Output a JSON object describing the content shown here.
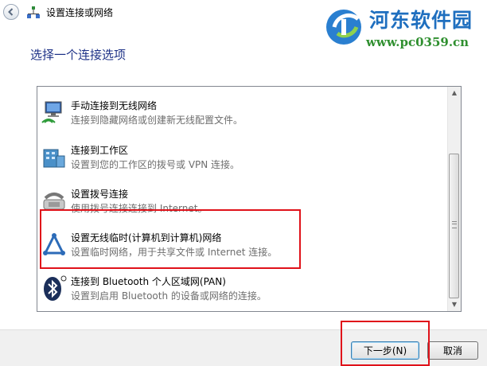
{
  "window": {
    "title": "设置连接或网络"
  },
  "watermark": {
    "name": "河东软件园",
    "url": "www.pc0359.cn"
  },
  "heading": "选择一个连接选项",
  "options": [
    {
      "title": "手动连接到无线网络",
      "description": "连接到隐藏网络或创建新无线配置文件。",
      "icon": "wireless-network-icon"
    },
    {
      "title": "连接到工作区",
      "description": "设置到您的工作区的拨号或 VPN 连接。",
      "icon": "workplace-icon"
    },
    {
      "title": "设置拨号连接",
      "description": "使用拨号连接连接到 Internet。",
      "icon": "dialup-phone-icon"
    },
    {
      "title": "设置无线临时(计算机到计算机)网络",
      "description": "设置临时网络，用于共享文件或 Internet 连接。",
      "icon": "adhoc-network-icon"
    },
    {
      "title": "连接到 Bluetooth 个人区域网(PAN)",
      "description": "设置到启用 Bluetooth 的设备或网络的连接。",
      "icon": "bluetooth-icon"
    }
  ],
  "buttons": {
    "next": "下一步(N)",
    "cancel": "取消"
  },
  "colors": {
    "heading": "#1e3287",
    "highlight": "#e0121a",
    "description": "#6d6d6d"
  }
}
